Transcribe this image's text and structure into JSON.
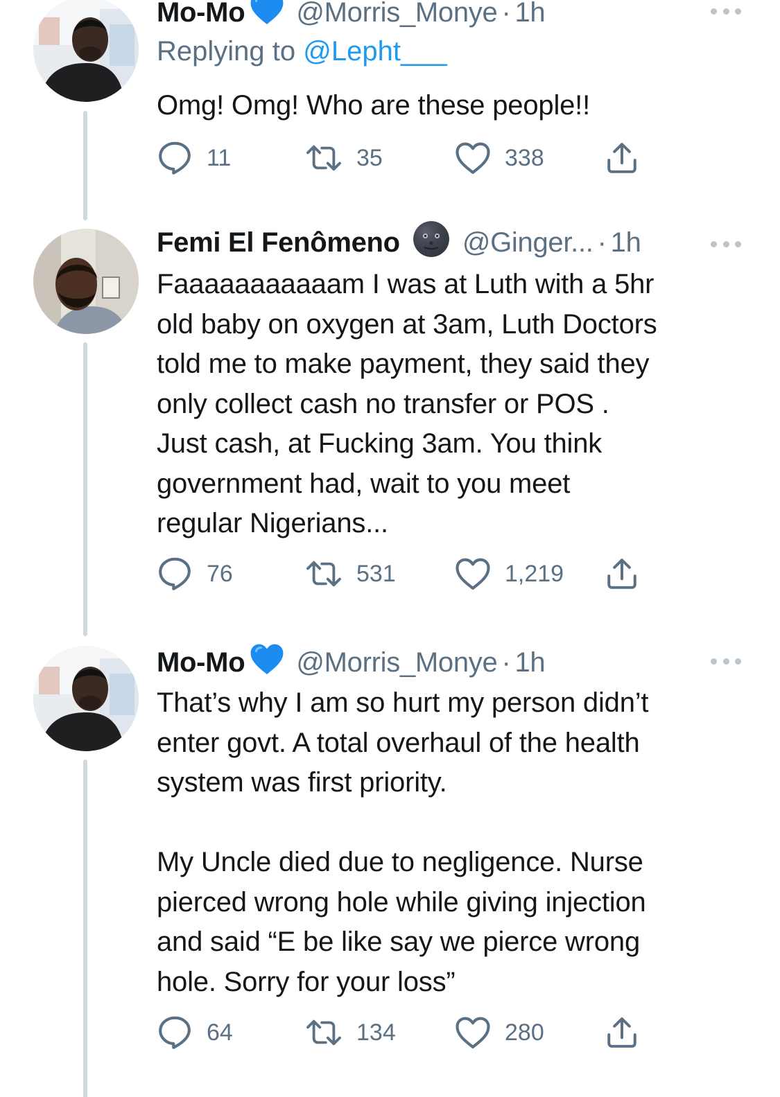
{
  "tweets": [
    {
      "name": "Mo-Mo",
      "badge": "blue-heart-icon",
      "handle": "@Morris_Monye",
      "dot": "·",
      "time": "1h",
      "replying_prefix": "Replying to",
      "replying_to": "@Lepht___",
      "text": "Omg! Omg! Who are these people!!",
      "replies": "11",
      "retweets": "35",
      "likes": "338"
    },
    {
      "name": "Femi El Fenômeno",
      "badge": "new-moon-face-emoji",
      "handle": "@Ginger...",
      "dot": "·",
      "time": "1h",
      "text": "Faaaaaaaaaaam I was at Luth with a 5hr\nold baby on oxygen at 3am, Luth Doctors\ntold me to make payment, they said they\nonly collect cash no transfer or POS .\nJust cash, at Fucking 3am. You think\ngovernment had, wait to you meet\nregular Nigerians...",
      "replies": "76",
      "retweets": "531",
      "likes": "1,219"
    },
    {
      "name": "Mo-Mo",
      "badge": "blue-heart-icon",
      "handle": "@Morris_Monye",
      "dot": "·",
      "time": "1h",
      "text": "That’s why I am so hurt my person didn’t\nenter govt. A total overhaul of the health\nsystem was first priority.\n\nMy Uncle died due to negligence. Nurse\npierced wrong hole while giving injection\nand said “E be like say we pierce wrong\nhole. Sorry for your loss”",
      "replies": "64",
      "retweets": "134",
      "likes": "280"
    }
  ],
  "colors": {
    "text": "#14171a",
    "secondary": "#5b7083",
    "link": "#1d9bf0",
    "heart": "#1d8cf0",
    "thread_line": "#cfd9de"
  },
  "icons": {
    "reply": "speech-bubble-icon",
    "retweet": "retweet-icon",
    "like": "heart-outline-icon",
    "share": "share-upload-icon",
    "more": "more-dots-icon"
  }
}
